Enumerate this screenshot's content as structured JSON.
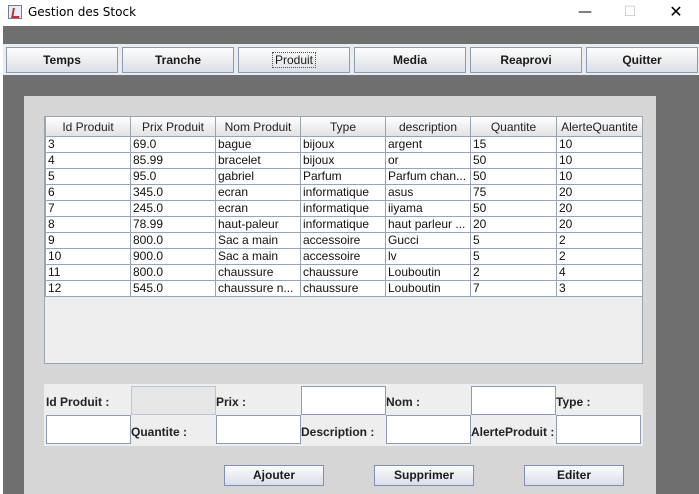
{
  "window": {
    "title": "Gestion des Stock",
    "controls": {
      "minimize": "—",
      "maximize": "☐",
      "close": "✕"
    }
  },
  "menu": {
    "items": [
      {
        "label": "Temps"
      },
      {
        "label": "Tranche"
      },
      {
        "label": "Produit"
      },
      {
        "label": "Media"
      },
      {
        "label": "Reaprovi"
      },
      {
        "label": "Quitter"
      }
    ],
    "active": "Produit"
  },
  "table": {
    "columns": [
      "Id Produit",
      "Prix Produit",
      "Nom Produit",
      "Type",
      "description",
      "Quantite",
      "AlerteQuantite"
    ],
    "rows": [
      [
        "3",
        "69.0",
        "bague",
        "bijoux",
        "argent",
        "15",
        "10"
      ],
      [
        "4",
        "85.99",
        "bracelet",
        "bijoux",
        "or",
        "50",
        "10"
      ],
      [
        "5",
        "95.0",
        "gabriel",
        "Parfum",
        "Parfum chan...",
        "50",
        "10"
      ],
      [
        "6",
        "345.0",
        "ecran",
        "informatique",
        "asus",
        "75",
        "20"
      ],
      [
        "7",
        "245.0",
        "ecran",
        "informatique",
        "iiyama",
        "50",
        "20"
      ],
      [
        "8",
        "78.99",
        "haut-paleur",
        "informatique",
        "haut parleur ...",
        "20",
        "20"
      ],
      [
        "9",
        "800.0",
        "Sac a main",
        "accessoire",
        "Gucci",
        "5",
        "2"
      ],
      [
        "10",
        "900.0",
        "Sac a main",
        "accessoire",
        "lv",
        "5",
        "2"
      ],
      [
        "11",
        "800.0",
        "chaussure",
        "chaussure",
        "Louboutin",
        "2",
        "4"
      ],
      [
        "12",
        "545.0",
        "chaussure n...",
        "chaussure",
        "Louboutin",
        "7",
        "3"
      ]
    ]
  },
  "form": {
    "id_label": "Id Produit :",
    "prix_label": "Prix :",
    "nom_label": "Nom :",
    "type_label": "Type :",
    "quantite_label": "Quantite :",
    "description_label": "Description :",
    "alerte_label": "AlerteProduit :",
    "id_value": "",
    "prix_value": "",
    "nom_value": "",
    "type_value": "",
    "quantite_value": "",
    "description_value": "",
    "alerte_value": ""
  },
  "actions": {
    "add_label": "Ajouter",
    "delete_label": "Supprimer",
    "edit_label": "Editer"
  },
  "colors": {
    "frame": "#6f6f6f",
    "panel": "#d6d6d6",
    "button_border": "#8a9bb8"
  }
}
